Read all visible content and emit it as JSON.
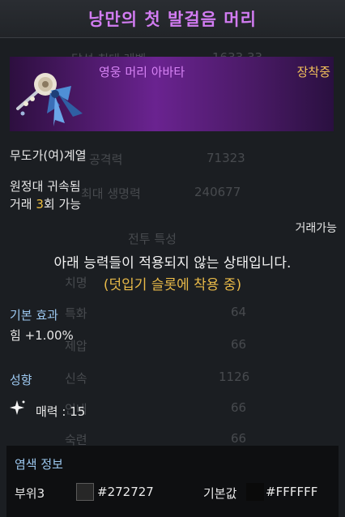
{
  "title": "낭만의 첫 발걸음 머리",
  "item_type": "영웅 머리 아바타",
  "equip_status": "장착중",
  "class_restriction": "무도가(여)계열",
  "bind_status": "원정대 귀속됨",
  "trade": {
    "prefix": "거래 ",
    "count": "3",
    "suffix": "회 가능"
  },
  "tradable_label": "거래가능",
  "notice": {
    "main": "아래 능력들이 적용되지 않는 상태입니다.",
    "sub": "(덧입기 슬롯에 착용 중)"
  },
  "basic_effect": {
    "label": "기본 효과",
    "stat": "힘 +1.00%"
  },
  "tendency": {
    "label": "성향",
    "charm": "매력 : 15"
  },
  "dye": {
    "title": "염색 정보",
    "part": "부위3",
    "part_color_hex": "#272727",
    "base_label": "기본값",
    "base_color_hex": "#FFFFFF"
  },
  "colors": {
    "title": "#d27cf2",
    "item_grade": "#d783f5",
    "equip": "#f2c15a",
    "section": "#9cc8f0",
    "highlight": "#f0c040"
  },
  "icons": {
    "avatar": "hair-accessory-icon",
    "sparkle": "sparkle-icon"
  }
}
